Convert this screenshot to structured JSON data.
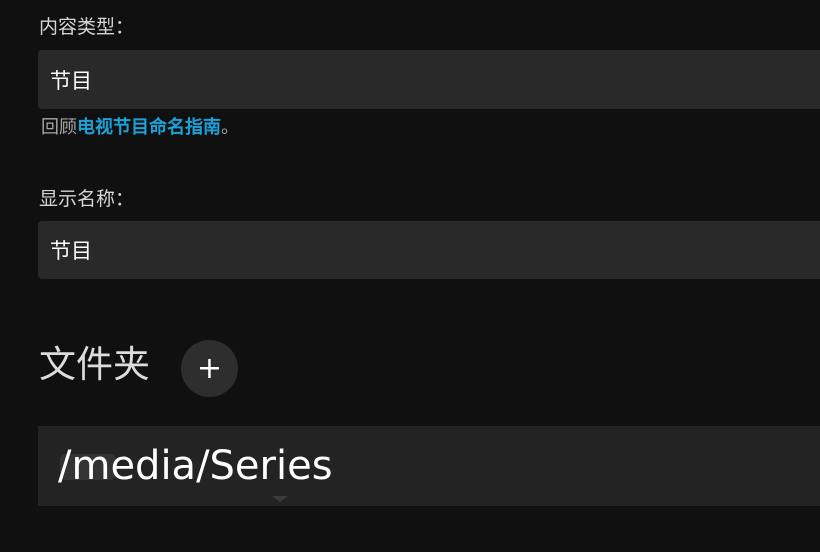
{
  "form": {
    "content_type": {
      "label": "内容类型：",
      "value": "节目",
      "help_prefix": "回顾",
      "help_link": "电视节目命名指南",
      "help_suffix": "。"
    },
    "display_name": {
      "label": "显示名称：",
      "value": "节目"
    }
  },
  "folders": {
    "title": "文件夹",
    "add_icon": "+",
    "items": [
      {
        "path": "/media/Series"
      }
    ]
  },
  "colors": {
    "background": "#101010",
    "field": "#292929",
    "link": "#1ca2d9"
  }
}
